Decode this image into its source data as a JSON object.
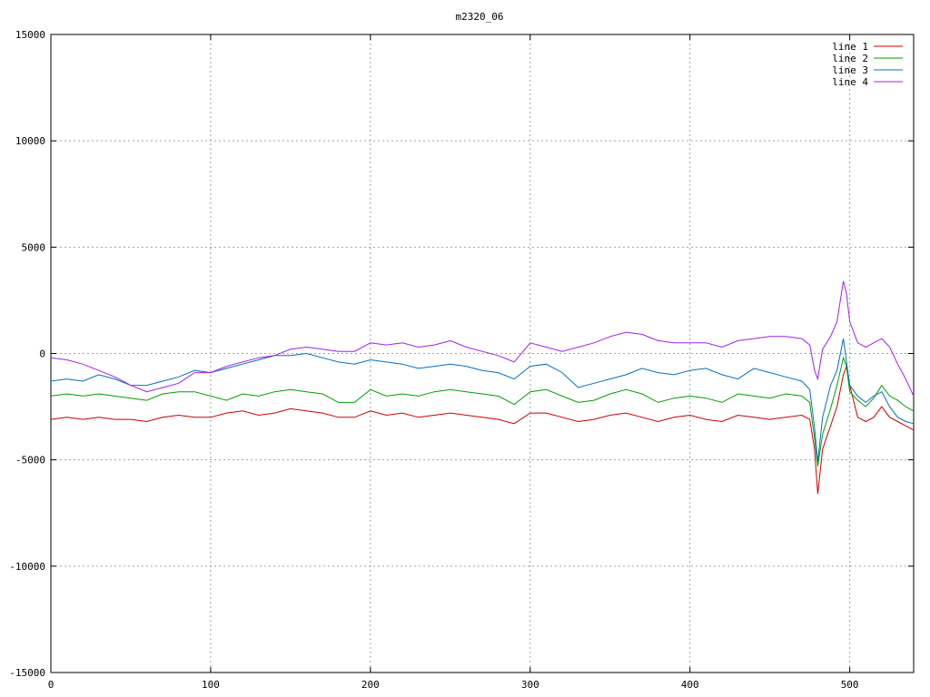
{
  "chart_data": {
    "type": "line",
    "title": "m2320_06",
    "xlabel": "",
    "ylabel": "",
    "xlim": [
      0,
      540
    ],
    "ylim": [
      -15000,
      15000
    ],
    "x_ticks": [
      0,
      100,
      200,
      300,
      400,
      500
    ],
    "y_ticks": [
      -15000,
      -10000,
      -5000,
      0,
      5000,
      10000,
      15000
    ],
    "grid": true,
    "legend_position": "top-right",
    "series": [
      {
        "name": "line 1",
        "color": "#cc0000",
        "points": [
          [
            0,
            -3100
          ],
          [
            10,
            -3000
          ],
          [
            20,
            -3100
          ],
          [
            30,
            -3000
          ],
          [
            40,
            -3100
          ],
          [
            50,
            -3100
          ],
          [
            60,
            -3200
          ],
          [
            70,
            -3000
          ],
          [
            80,
            -2900
          ],
          [
            90,
            -3000
          ],
          [
            100,
            -3000
          ],
          [
            110,
            -2800
          ],
          [
            120,
            -2700
          ],
          [
            130,
            -2900
          ],
          [
            140,
            -2800
          ],
          [
            150,
            -2600
          ],
          [
            160,
            -2700
          ],
          [
            170,
            -2800
          ],
          [
            180,
            -3000
          ],
          [
            190,
            -3000
          ],
          [
            200,
            -2700
          ],
          [
            210,
            -2900
          ],
          [
            220,
            -2800
          ],
          [
            230,
            -3000
          ],
          [
            240,
            -2900
          ],
          [
            250,
            -2800
          ],
          [
            260,
            -2900
          ],
          [
            270,
            -3000
          ],
          [
            280,
            -3100
          ],
          [
            290,
            -3300
          ],
          [
            300,
            -2800
          ],
          [
            310,
            -2800
          ],
          [
            320,
            -3000
          ],
          [
            330,
            -3200
          ],
          [
            340,
            -3100
          ],
          [
            350,
            -2900
          ],
          [
            360,
            -2800
          ],
          [
            370,
            -3000
          ],
          [
            380,
            -3200
          ],
          [
            390,
            -3000
          ],
          [
            400,
            -2900
          ],
          [
            410,
            -3100
          ],
          [
            420,
            -3200
          ],
          [
            430,
            -2900
          ],
          [
            440,
            -3000
          ],
          [
            450,
            -3100
          ],
          [
            460,
            -3000
          ],
          [
            470,
            -2900
          ],
          [
            475,
            -3100
          ],
          [
            478,
            -4500
          ],
          [
            480,
            -6600
          ],
          [
            483,
            -4500
          ],
          [
            488,
            -3400
          ],
          [
            492,
            -2500
          ],
          [
            496,
            -1000
          ],
          [
            498,
            -600
          ],
          [
            500,
            -1500
          ],
          [
            505,
            -3000
          ],
          [
            510,
            -3200
          ],
          [
            515,
            -3000
          ],
          [
            520,
            -2500
          ],
          [
            525,
            -3000
          ],
          [
            530,
            -3200
          ],
          [
            535,
            -3400
          ],
          [
            540,
            -3600
          ]
        ]
      },
      {
        "name": "line 2",
        "color": "#00a000",
        "points": [
          [
            0,
            -2000
          ],
          [
            10,
            -1900
          ],
          [
            20,
            -2000
          ],
          [
            30,
            -1900
          ],
          [
            40,
            -2000
          ],
          [
            50,
            -2100
          ],
          [
            60,
            -2200
          ],
          [
            70,
            -1900
          ],
          [
            80,
            -1800
          ],
          [
            90,
            -1800
          ],
          [
            100,
            -2000
          ],
          [
            110,
            -2200
          ],
          [
            120,
            -1900
          ],
          [
            130,
            -2000
          ],
          [
            140,
            -1800
          ],
          [
            150,
            -1700
          ],
          [
            160,
            -1800
          ],
          [
            170,
            -1900
          ],
          [
            180,
            -2300
          ],
          [
            190,
            -2300
          ],
          [
            200,
            -1700
          ],
          [
            210,
            -2000
          ],
          [
            220,
            -1900
          ],
          [
            230,
            -2000
          ],
          [
            240,
            -1800
          ],
          [
            250,
            -1700
          ],
          [
            260,
            -1800
          ],
          [
            270,
            -1900
          ],
          [
            280,
            -2000
          ],
          [
            290,
            -2400
          ],
          [
            300,
            -1800
          ],
          [
            310,
            -1700
          ],
          [
            320,
            -2000
          ],
          [
            330,
            -2300
          ],
          [
            340,
            -2200
          ],
          [
            350,
            -1900
          ],
          [
            360,
            -1700
          ],
          [
            370,
            -1900
          ],
          [
            380,
            -2300
          ],
          [
            390,
            -2100
          ],
          [
            400,
            -2000
          ],
          [
            410,
            -2100
          ],
          [
            420,
            -2300
          ],
          [
            430,
            -1900
          ],
          [
            440,
            -2000
          ],
          [
            450,
            -2100
          ],
          [
            460,
            -1900
          ],
          [
            470,
            -2000
          ],
          [
            475,
            -2300
          ],
          [
            478,
            -4000
          ],
          [
            480,
            -5300
          ],
          [
            483,
            -3800
          ],
          [
            488,
            -2600
          ],
          [
            492,
            -1500
          ],
          [
            496,
            -200
          ],
          [
            498,
            -600
          ],
          [
            500,
            -1800
          ],
          [
            505,
            -2200
          ],
          [
            510,
            -2500
          ],
          [
            515,
            -2100
          ],
          [
            520,
            -1500
          ],
          [
            525,
            -2000
          ],
          [
            530,
            -2200
          ],
          [
            535,
            -2500
          ],
          [
            540,
            -2700
          ]
        ]
      },
      {
        "name": "line 3",
        "color": "#0070c0",
        "points": [
          [
            0,
            -1300
          ],
          [
            10,
            -1200
          ],
          [
            20,
            -1300
          ],
          [
            30,
            -1000
          ],
          [
            40,
            -1200
          ],
          [
            50,
            -1500
          ],
          [
            60,
            -1500
          ],
          [
            70,
            -1300
          ],
          [
            80,
            -1100
          ],
          [
            90,
            -800
          ],
          [
            100,
            -900
          ],
          [
            110,
            -700
          ],
          [
            120,
            -500
          ],
          [
            130,
            -300
          ],
          [
            140,
            -100
          ],
          [
            150,
            -100
          ],
          [
            160,
            0
          ],
          [
            170,
            -200
          ],
          [
            180,
            -400
          ],
          [
            190,
            -500
          ],
          [
            200,
            -300
          ],
          [
            210,
            -400
          ],
          [
            220,
            -500
          ],
          [
            230,
            -700
          ],
          [
            240,
            -600
          ],
          [
            250,
            -500
          ],
          [
            260,
            -600
          ],
          [
            270,
            -800
          ],
          [
            280,
            -900
          ],
          [
            290,
            -1200
          ],
          [
            300,
            -600
          ],
          [
            310,
            -500
          ],
          [
            320,
            -900
          ],
          [
            330,
            -1600
          ],
          [
            340,
            -1400
          ],
          [
            350,
            -1200
          ],
          [
            360,
            -1000
          ],
          [
            370,
            -700
          ],
          [
            380,
            -900
          ],
          [
            390,
            -1000
          ],
          [
            400,
            -800
          ],
          [
            410,
            -700
          ],
          [
            420,
            -1000
          ],
          [
            430,
            -1200
          ],
          [
            440,
            -700
          ],
          [
            450,
            -900
          ],
          [
            460,
            -1100
          ],
          [
            470,
            -1300
          ],
          [
            475,
            -1700
          ],
          [
            478,
            -3500
          ],
          [
            480,
            -5100
          ],
          [
            483,
            -3000
          ],
          [
            488,
            -1500
          ],
          [
            492,
            -800
          ],
          [
            496,
            700
          ],
          [
            498,
            -400
          ],
          [
            500,
            -1500
          ],
          [
            505,
            -2000
          ],
          [
            510,
            -2300
          ],
          [
            515,
            -2000
          ],
          [
            520,
            -1800
          ],
          [
            525,
            -2500
          ],
          [
            530,
            -3000
          ],
          [
            535,
            -3200
          ],
          [
            540,
            -3300
          ]
        ]
      },
      {
        "name": "line 4",
        "color": "#a020f0",
        "points": [
          [
            0,
            -200
          ],
          [
            10,
            -300
          ],
          [
            20,
            -500
          ],
          [
            30,
            -800
          ],
          [
            40,
            -1100
          ],
          [
            50,
            -1500
          ],
          [
            60,
            -1800
          ],
          [
            70,
            -1600
          ],
          [
            80,
            -1400
          ],
          [
            90,
            -900
          ],
          [
            100,
            -900
          ],
          [
            110,
            -600
          ],
          [
            120,
            -400
          ],
          [
            130,
            -200
          ],
          [
            140,
            -100
          ],
          [
            150,
            200
          ],
          [
            160,
            300
          ],
          [
            170,
            200
          ],
          [
            180,
            100
          ],
          [
            190,
            100
          ],
          [
            200,
            500
          ],
          [
            210,
            400
          ],
          [
            220,
            500
          ],
          [
            230,
            300
          ],
          [
            240,
            400
          ],
          [
            250,
            600
          ],
          [
            260,
            300
          ],
          [
            270,
            100
          ],
          [
            280,
            -100
          ],
          [
            290,
            -400
          ],
          [
            300,
            500
          ],
          [
            310,
            300
          ],
          [
            320,
            100
          ],
          [
            330,
            300
          ],
          [
            340,
            500
          ],
          [
            350,
            800
          ],
          [
            360,
            1000
          ],
          [
            370,
            900
          ],
          [
            380,
            600
          ],
          [
            390,
            500
          ],
          [
            400,
            500
          ],
          [
            410,
            500
          ],
          [
            420,
            300
          ],
          [
            430,
            600
          ],
          [
            440,
            700
          ],
          [
            450,
            800
          ],
          [
            460,
            800
          ],
          [
            470,
            700
          ],
          [
            475,
            400
          ],
          [
            478,
            -800
          ],
          [
            480,
            -1200
          ],
          [
            483,
            200
          ],
          [
            488,
            800
          ],
          [
            492,
            1500
          ],
          [
            496,
            3400
          ],
          [
            498,
            2800
          ],
          [
            500,
            1500
          ],
          [
            505,
            500
          ],
          [
            510,
            300
          ],
          [
            515,
            500
          ],
          [
            520,
            700
          ],
          [
            525,
            300
          ],
          [
            530,
            -500
          ],
          [
            535,
            -1200
          ],
          [
            540,
            -2000
          ]
        ]
      }
    ]
  }
}
